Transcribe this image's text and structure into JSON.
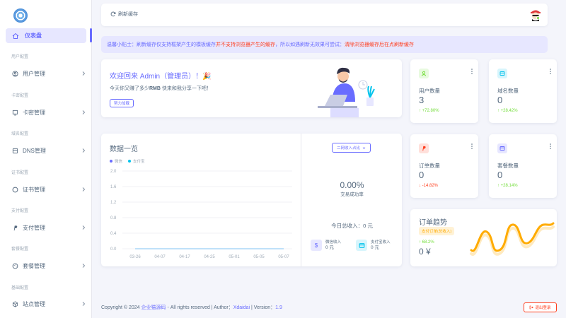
{
  "sidebar": {
    "active_item": "仪表盘",
    "groups": [
      {
        "header": "用户配置",
        "item": "用户管理"
      },
      {
        "header": "卡密配置",
        "item": "卡密管理"
      },
      {
        "header": "域名配置",
        "item": "DNS管理"
      },
      {
        "header": "证书配置",
        "item": "证书管理"
      },
      {
        "header": "支付配置",
        "item": "支付管理"
      },
      {
        "header": "套餐配置",
        "item": "套餐管理"
      },
      {
        "header": "基础配置",
        "item": "站点管理"
      }
    ]
  },
  "topbar": {
    "refresh_label": "刷新缓存"
  },
  "alert": {
    "prefix": "温馨小贴士：刷新缓存仅支持框架产生的模板缓存",
    "red1": "并不支持浏览器产生的缓存",
    "middle": "，所以如遇刷新无效果可尝试：",
    "red2": "清除浏览器缓存后在点刷新缓存"
  },
  "welcome": {
    "title": "欢迎回来 Admin（管理员）！🎉",
    "sub_before": "今天你又赚了多少",
    "sub_bold": "RMB",
    "sub_after": " 快来和我分享一下吧！",
    "button": "努力加载"
  },
  "stats": [
    {
      "label": "用户数量",
      "value": "3",
      "delta": "+72.80%",
      "dir": "up",
      "color": "#71dd37",
      "bg": "#e8fadf",
      "icon": "user-icon"
    },
    {
      "label": "域名数量",
      "value": "0",
      "delta": "+28.42%",
      "dir": "up",
      "color": "#03c3ec",
      "bg": "#d7f5fc",
      "icon": "wallet-icon"
    },
    {
      "label": "订单数量",
      "value": "0",
      "delta": "-14.82%",
      "dir": "down",
      "color": "#ff3e1d",
      "bg": "#ffe0db",
      "icon": "paypal-icon"
    },
    {
      "label": "套餐数量",
      "value": "0",
      "delta": "+28.14%",
      "dir": "up",
      "color": "#696cff",
      "bg": "#e7e7ff",
      "icon": "card-icon"
    }
  ],
  "overview": {
    "title": "数据一览",
    "select_label": "二网收入占比",
    "rate": "0.00%",
    "rate_label": "交易成功率",
    "today_label": "今日总收入：0 元",
    "wechat_label": "微信收入",
    "wechat_amount": "0 元",
    "alipay_label": "支付宝收入",
    "alipay_amount": "0 元"
  },
  "chart_data": {
    "type": "line",
    "categories": [
      "03-26",
      "04-07",
      "04-17",
      "04-25",
      "05-01",
      "05-05",
      "05-07"
    ],
    "series": [
      {
        "name": "微信",
        "values": [
          0,
          0,
          0,
          0,
          0,
          0,
          0
        ],
        "color": "#696cff"
      },
      {
        "name": "支付宝",
        "values": [
          0,
          0,
          0,
          0,
          0,
          0,
          0
        ],
        "color": "#03c3ec"
      }
    ],
    "yticks": [
      "2.0",
      "1.6",
      "1.2",
      "0.8",
      "0.4",
      "0.0"
    ],
    "ylim": [
      0,
      2.0
    ],
    "grid": true,
    "legend": "top-left"
  },
  "trend": {
    "title": "订单趋势",
    "tag": "支付订单(总收入)",
    "pct": "68.2%",
    "value": "0 ¥"
  },
  "footer": {
    "prefix": "Copyright © 2024 ",
    "brand": "企业猫源码",
    "middle": " - All rights reserved | Author：",
    "author": "Xdaidai",
    "version_prefix": " | Version：",
    "version": "1.9"
  },
  "logout": {
    "label": "退出登录"
  },
  "colors": {
    "primary": "#696cff",
    "success": "#71dd37",
    "danger": "#ff3e1d",
    "warning": "#ffab00",
    "info": "#03c3ec"
  }
}
